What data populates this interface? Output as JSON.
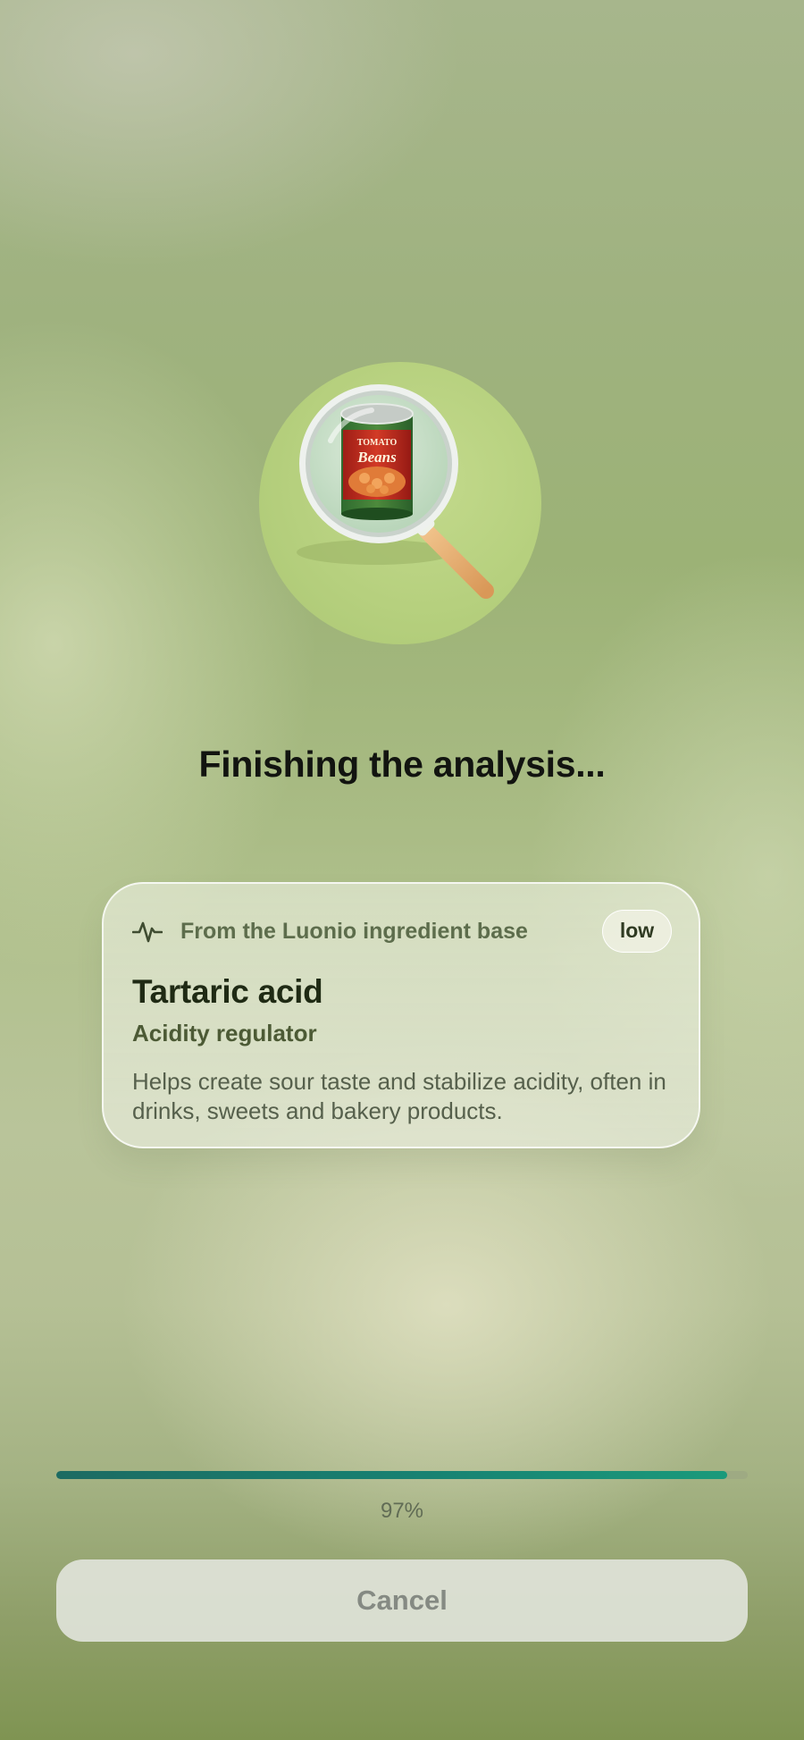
{
  "hero": {
    "illustration": "magnifying-glass-over-can",
    "can_label_top": "TOMATO",
    "can_label_main": "Beans"
  },
  "status": {
    "title": "Finishing the analysis..."
  },
  "ingredient_card": {
    "source_icon": "pulse-icon",
    "source_text": "From the Luonio ingredient base",
    "level": "low",
    "name": "Tartaric acid",
    "category": "Acidity regulator",
    "description": "Helps create sour taste and stabilize acidity, often in drinks, sweets and bakery products."
  },
  "progress": {
    "percent": 97,
    "label": "97%"
  },
  "actions": {
    "cancel_label": "Cancel"
  },
  "colors": {
    "progress_fill": "#178272",
    "accent_green": "#b6d07e"
  }
}
